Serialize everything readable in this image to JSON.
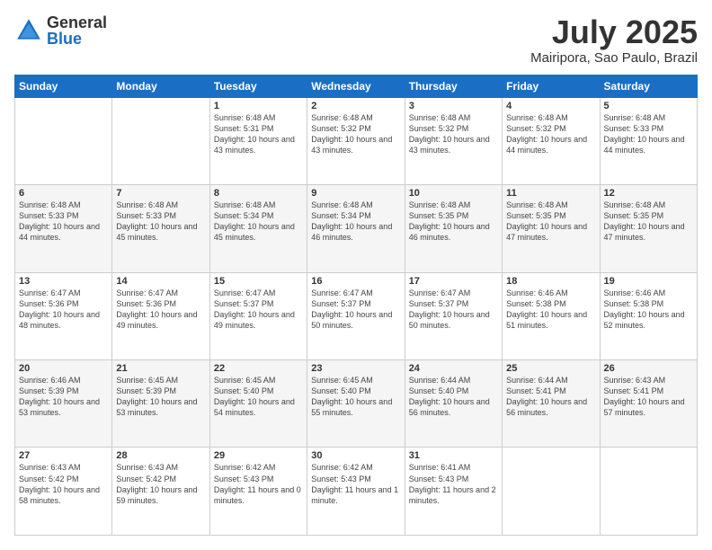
{
  "header": {
    "logo": {
      "general": "General",
      "blue": "Blue"
    },
    "title": "July 2025",
    "location": "Mairipora, Sao Paulo, Brazil"
  },
  "weekdays": [
    "Sunday",
    "Monday",
    "Tuesday",
    "Wednesday",
    "Thursday",
    "Friday",
    "Saturday"
  ],
  "weeks": [
    [
      {
        "day": "",
        "sunrise": "",
        "sunset": "",
        "daylight": ""
      },
      {
        "day": "",
        "sunrise": "",
        "sunset": "",
        "daylight": ""
      },
      {
        "day": "1",
        "sunrise": "Sunrise: 6:48 AM",
        "sunset": "Sunset: 5:31 PM",
        "daylight": "Daylight: 10 hours and 43 minutes."
      },
      {
        "day": "2",
        "sunrise": "Sunrise: 6:48 AM",
        "sunset": "Sunset: 5:32 PM",
        "daylight": "Daylight: 10 hours and 43 minutes."
      },
      {
        "day": "3",
        "sunrise": "Sunrise: 6:48 AM",
        "sunset": "Sunset: 5:32 PM",
        "daylight": "Daylight: 10 hours and 43 minutes."
      },
      {
        "day": "4",
        "sunrise": "Sunrise: 6:48 AM",
        "sunset": "Sunset: 5:32 PM",
        "daylight": "Daylight: 10 hours and 44 minutes."
      },
      {
        "day": "5",
        "sunrise": "Sunrise: 6:48 AM",
        "sunset": "Sunset: 5:33 PM",
        "daylight": "Daylight: 10 hours and 44 minutes."
      }
    ],
    [
      {
        "day": "6",
        "sunrise": "Sunrise: 6:48 AM",
        "sunset": "Sunset: 5:33 PM",
        "daylight": "Daylight: 10 hours and 44 minutes."
      },
      {
        "day": "7",
        "sunrise": "Sunrise: 6:48 AM",
        "sunset": "Sunset: 5:33 PM",
        "daylight": "Daylight: 10 hours and 45 minutes."
      },
      {
        "day": "8",
        "sunrise": "Sunrise: 6:48 AM",
        "sunset": "Sunset: 5:34 PM",
        "daylight": "Daylight: 10 hours and 45 minutes."
      },
      {
        "day": "9",
        "sunrise": "Sunrise: 6:48 AM",
        "sunset": "Sunset: 5:34 PM",
        "daylight": "Daylight: 10 hours and 46 minutes."
      },
      {
        "day": "10",
        "sunrise": "Sunrise: 6:48 AM",
        "sunset": "Sunset: 5:35 PM",
        "daylight": "Daylight: 10 hours and 46 minutes."
      },
      {
        "day": "11",
        "sunrise": "Sunrise: 6:48 AM",
        "sunset": "Sunset: 5:35 PM",
        "daylight": "Daylight: 10 hours and 47 minutes."
      },
      {
        "day": "12",
        "sunrise": "Sunrise: 6:48 AM",
        "sunset": "Sunset: 5:35 PM",
        "daylight": "Daylight: 10 hours and 47 minutes."
      }
    ],
    [
      {
        "day": "13",
        "sunrise": "Sunrise: 6:47 AM",
        "sunset": "Sunset: 5:36 PM",
        "daylight": "Daylight: 10 hours and 48 minutes."
      },
      {
        "day": "14",
        "sunrise": "Sunrise: 6:47 AM",
        "sunset": "Sunset: 5:36 PM",
        "daylight": "Daylight: 10 hours and 49 minutes."
      },
      {
        "day": "15",
        "sunrise": "Sunrise: 6:47 AM",
        "sunset": "Sunset: 5:37 PM",
        "daylight": "Daylight: 10 hours and 49 minutes."
      },
      {
        "day": "16",
        "sunrise": "Sunrise: 6:47 AM",
        "sunset": "Sunset: 5:37 PM",
        "daylight": "Daylight: 10 hours and 50 minutes."
      },
      {
        "day": "17",
        "sunrise": "Sunrise: 6:47 AM",
        "sunset": "Sunset: 5:37 PM",
        "daylight": "Daylight: 10 hours and 50 minutes."
      },
      {
        "day": "18",
        "sunrise": "Sunrise: 6:46 AM",
        "sunset": "Sunset: 5:38 PM",
        "daylight": "Daylight: 10 hours and 51 minutes."
      },
      {
        "day": "19",
        "sunrise": "Sunrise: 6:46 AM",
        "sunset": "Sunset: 5:38 PM",
        "daylight": "Daylight: 10 hours and 52 minutes."
      }
    ],
    [
      {
        "day": "20",
        "sunrise": "Sunrise: 6:46 AM",
        "sunset": "Sunset: 5:39 PM",
        "daylight": "Daylight: 10 hours and 53 minutes."
      },
      {
        "day": "21",
        "sunrise": "Sunrise: 6:45 AM",
        "sunset": "Sunset: 5:39 PM",
        "daylight": "Daylight: 10 hours and 53 minutes."
      },
      {
        "day": "22",
        "sunrise": "Sunrise: 6:45 AM",
        "sunset": "Sunset: 5:40 PM",
        "daylight": "Daylight: 10 hours and 54 minutes."
      },
      {
        "day": "23",
        "sunrise": "Sunrise: 6:45 AM",
        "sunset": "Sunset: 5:40 PM",
        "daylight": "Daylight: 10 hours and 55 minutes."
      },
      {
        "day": "24",
        "sunrise": "Sunrise: 6:44 AM",
        "sunset": "Sunset: 5:40 PM",
        "daylight": "Daylight: 10 hours and 56 minutes."
      },
      {
        "day": "25",
        "sunrise": "Sunrise: 6:44 AM",
        "sunset": "Sunset: 5:41 PM",
        "daylight": "Daylight: 10 hours and 56 minutes."
      },
      {
        "day": "26",
        "sunrise": "Sunrise: 6:43 AM",
        "sunset": "Sunset: 5:41 PM",
        "daylight": "Daylight: 10 hours and 57 minutes."
      }
    ],
    [
      {
        "day": "27",
        "sunrise": "Sunrise: 6:43 AM",
        "sunset": "Sunset: 5:42 PM",
        "daylight": "Daylight: 10 hours and 58 minutes."
      },
      {
        "day": "28",
        "sunrise": "Sunrise: 6:43 AM",
        "sunset": "Sunset: 5:42 PM",
        "daylight": "Daylight: 10 hours and 59 minutes."
      },
      {
        "day": "29",
        "sunrise": "Sunrise: 6:42 AM",
        "sunset": "Sunset: 5:43 PM",
        "daylight": "Daylight: 11 hours and 0 minutes."
      },
      {
        "day": "30",
        "sunrise": "Sunrise: 6:42 AM",
        "sunset": "Sunset: 5:43 PM",
        "daylight": "Daylight: 11 hours and 1 minute."
      },
      {
        "day": "31",
        "sunrise": "Sunrise: 6:41 AM",
        "sunset": "Sunset: 5:43 PM",
        "daylight": "Daylight: 11 hours and 2 minutes."
      },
      {
        "day": "",
        "sunrise": "",
        "sunset": "",
        "daylight": ""
      },
      {
        "day": "",
        "sunrise": "",
        "sunset": "",
        "daylight": ""
      }
    ]
  ]
}
